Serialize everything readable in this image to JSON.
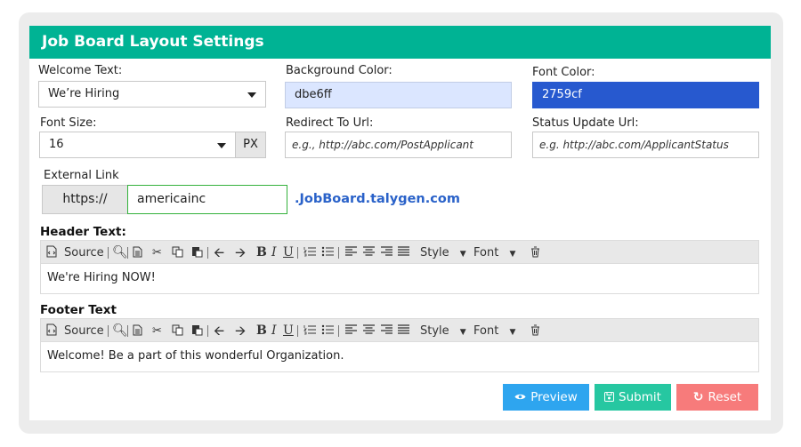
{
  "title": "Job Board Layout Settings",
  "welcome": {
    "label": "Welcome Text:",
    "value": "We’re Hiring"
  },
  "background": {
    "label": "Background Color:",
    "value": "dbe6ff",
    "color": "#dbe6ff"
  },
  "font_color": {
    "label": "Font Color:",
    "value": "2759cf",
    "color": "#2759cf"
  },
  "font_size": {
    "label": "Font Size:",
    "value": "16",
    "unit": "PX"
  },
  "redirect": {
    "label": "Redirect To Url:",
    "placeholder": "e.g., http://abc.com/PostApplicant"
  },
  "status_url": {
    "label": "Status Update Url:",
    "placeholder": "e.g. http://abc.com/ApplicantStatus"
  },
  "external": {
    "label": "External Link",
    "prefix": "https://",
    "value": "americainc",
    "suffix": ".JobBoard.talygen.com"
  },
  "toolbar": {
    "source": "Source",
    "bold": "B",
    "italic": "I",
    "underline": "U",
    "style": "Style",
    "font": "Font"
  },
  "header_text": {
    "label": "Header Text:",
    "content": "We're Hiring NOW!"
  },
  "footer_text": {
    "label": "Footer Text",
    "content": "Welcome! Be a part of this wonderful Organization."
  },
  "buttons": {
    "preview": {
      "label": "Preview",
      "color": "#2ea5ef"
    },
    "submit": {
      "label": "Submit",
      "color": "#26c7a1"
    },
    "reset": {
      "label": "Reset",
      "color": "#f77b7b"
    }
  },
  "accent": "#00b394"
}
